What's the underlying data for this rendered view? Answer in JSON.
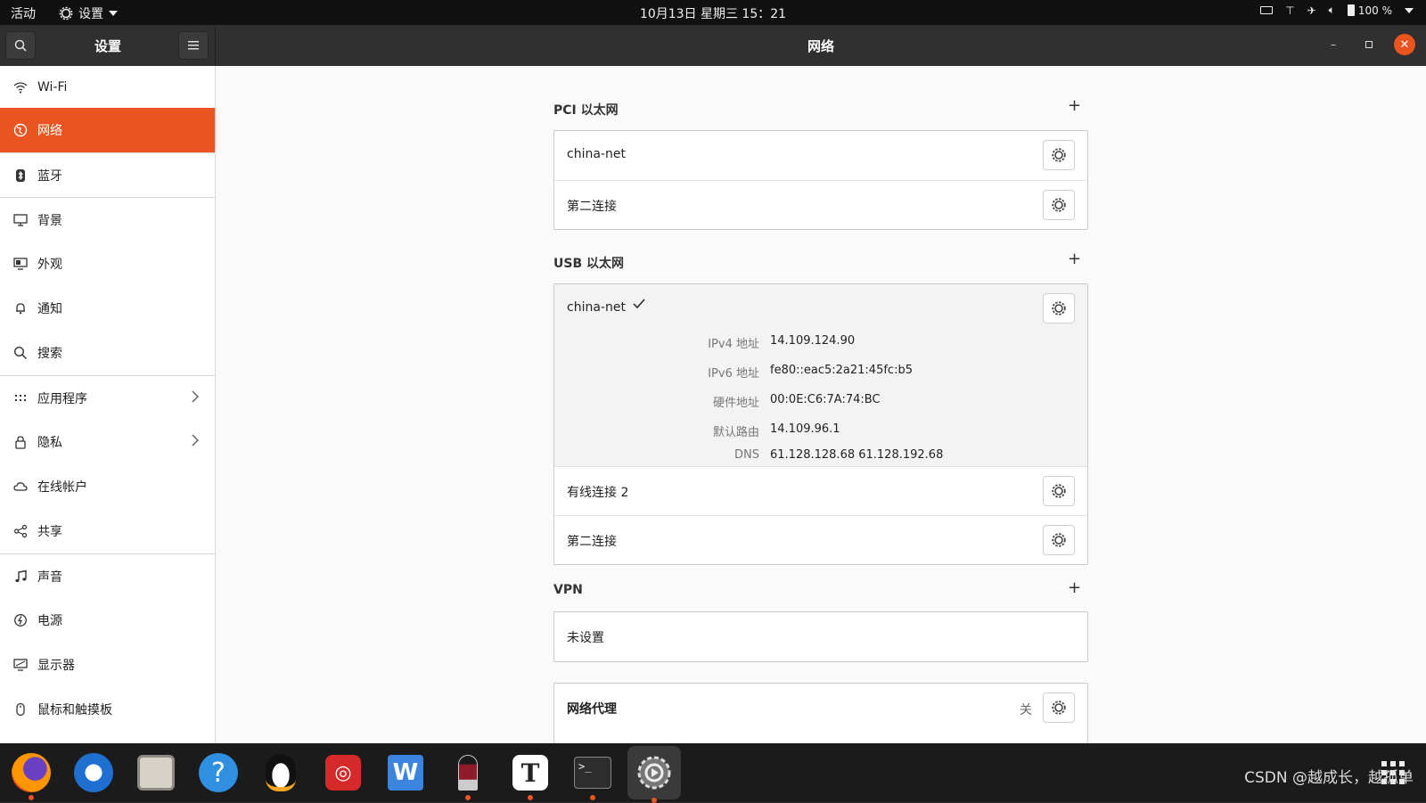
{
  "topbar": {
    "activities": "活动",
    "app_menu": "设置",
    "clock": "10月13日 星期三  15：21",
    "battery": "100 %"
  },
  "headerbar": {
    "sidebar_title": "设置",
    "page_title": "网络"
  },
  "sidebar": {
    "items": [
      {
        "label": "Wi-Fi",
        "icon": "wifi-icon"
      },
      {
        "label": "网络",
        "icon": "network-icon"
      },
      {
        "label": "蓝牙",
        "icon": "bluetooth-icon"
      },
      {
        "label": "背景",
        "icon": "background-icon"
      },
      {
        "label": "外观",
        "icon": "appearance-icon"
      },
      {
        "label": "通知",
        "icon": "bell-icon"
      },
      {
        "label": "搜索",
        "icon": "search-icon"
      },
      {
        "label": "应用程序",
        "icon": "apps-grid-icon"
      },
      {
        "label": "隐私",
        "icon": "lock-icon"
      },
      {
        "label": "在线帐户",
        "icon": "cloud-icon"
      },
      {
        "label": "共享",
        "icon": "share-icon"
      },
      {
        "label": "声音",
        "icon": "music-note-icon"
      },
      {
        "label": "电源",
        "icon": "power-icon"
      },
      {
        "label": "显示器",
        "icon": "display-icon"
      },
      {
        "label": "鼠标和触摸板",
        "icon": "mouse-icon"
      }
    ]
  },
  "pci": {
    "title": "PCI 以太网",
    "rows": [
      "china-net",
      "第二连接"
    ]
  },
  "usb": {
    "title": "USB 以太网",
    "active": "china-net",
    "details": [
      {
        "k": "IPv4 地址",
        "v": "14.109.124.90"
      },
      {
        "k": "IPv6 地址",
        "v": "fe80::eac5:2a21:45fc:b5"
      },
      {
        "k": "硬件地址",
        "v": "00:0E:C6:7A:74:BC"
      },
      {
        "k": "默认路由",
        "v": "14.109.96.1"
      },
      {
        "k": "DNS",
        "v": "61.128.128.68 61.128.192.68"
      }
    ],
    "rows": [
      "有线连接 2",
      "第二连接"
    ]
  },
  "vpn": {
    "title": "VPN",
    "empty": "未设置"
  },
  "proxy": {
    "label": "网络代理",
    "state": "关"
  },
  "watermark": "CSDN @越成长，越孤单",
  "colors": {
    "accent": "#e95420",
    "headerbar": "#303030"
  }
}
